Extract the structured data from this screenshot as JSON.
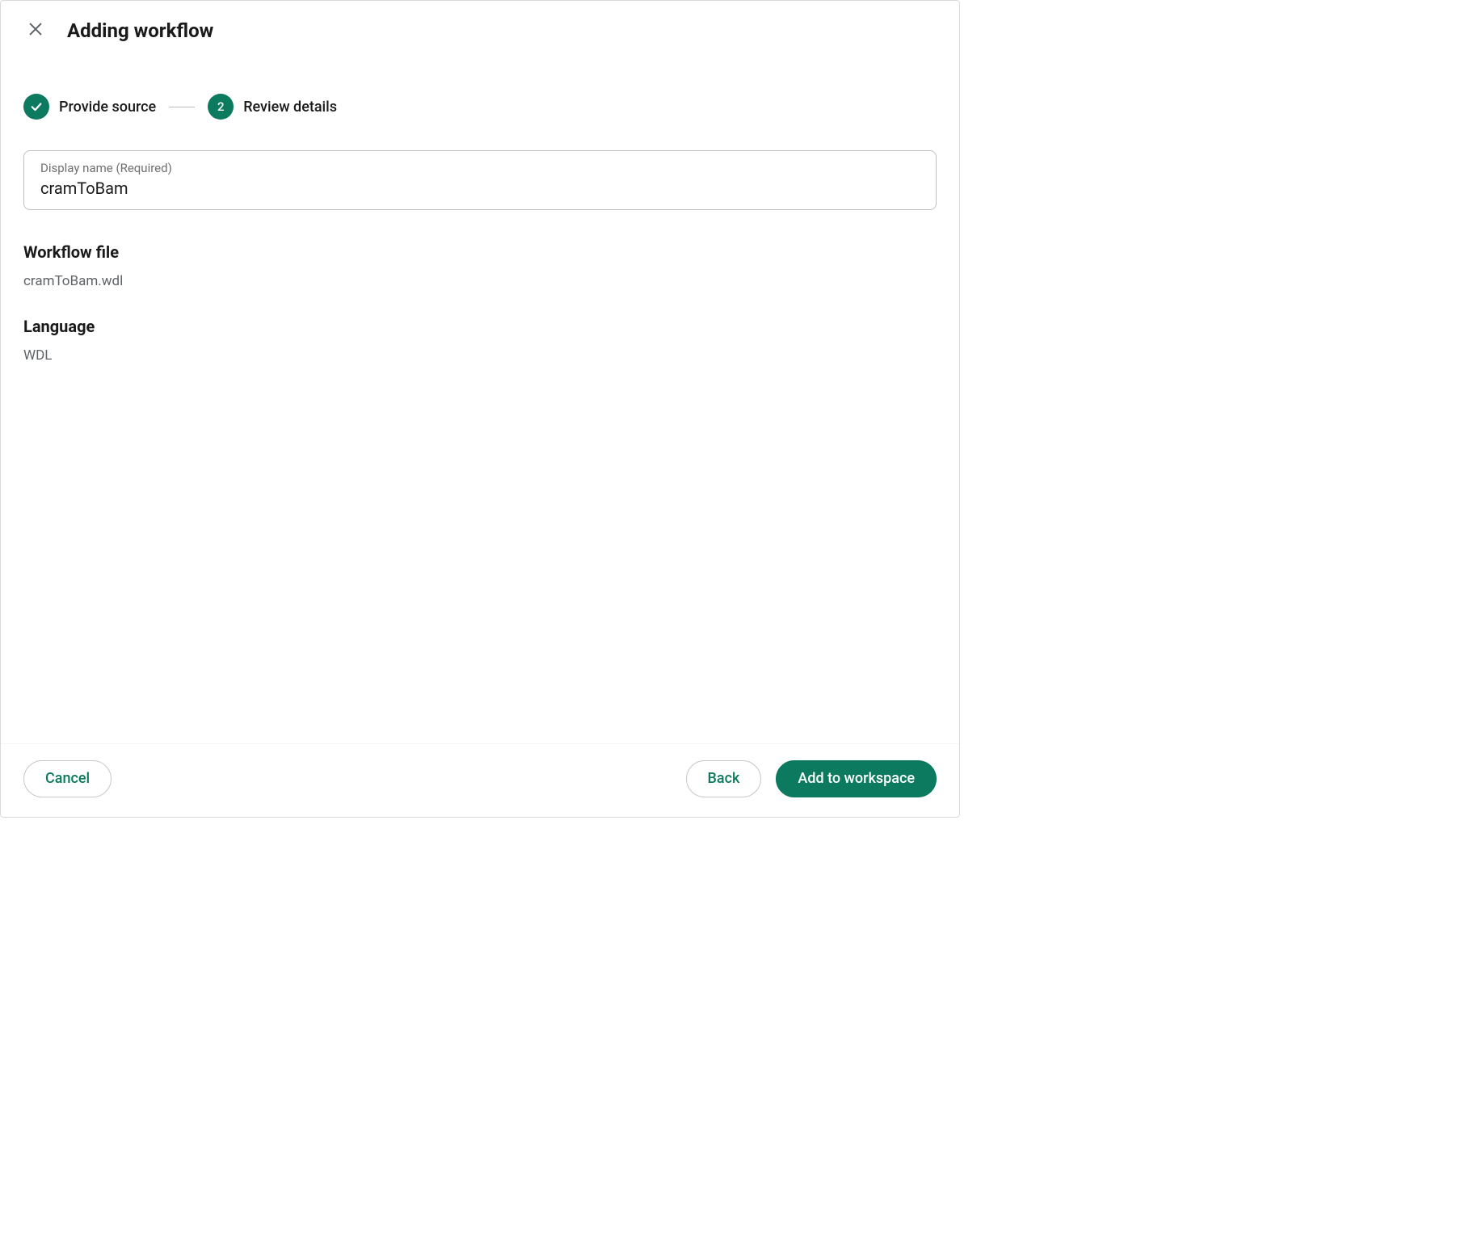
{
  "dialog": {
    "title": "Adding workflow"
  },
  "stepper": {
    "step1": {
      "label": "Provide source",
      "completed": true
    },
    "step2": {
      "number": "2",
      "label": "Review details"
    }
  },
  "form": {
    "display_name": {
      "label": "Display name (Required)",
      "value": "cramToBam"
    }
  },
  "sections": {
    "workflow_file": {
      "heading": "Workflow file",
      "value": "cramToBam.wdl"
    },
    "language": {
      "heading": "Language",
      "value": "WDL"
    }
  },
  "footer": {
    "cancel": "Cancel",
    "back": "Back",
    "add": "Add to workspace"
  },
  "colors": {
    "accent": "#0b7a5e"
  }
}
